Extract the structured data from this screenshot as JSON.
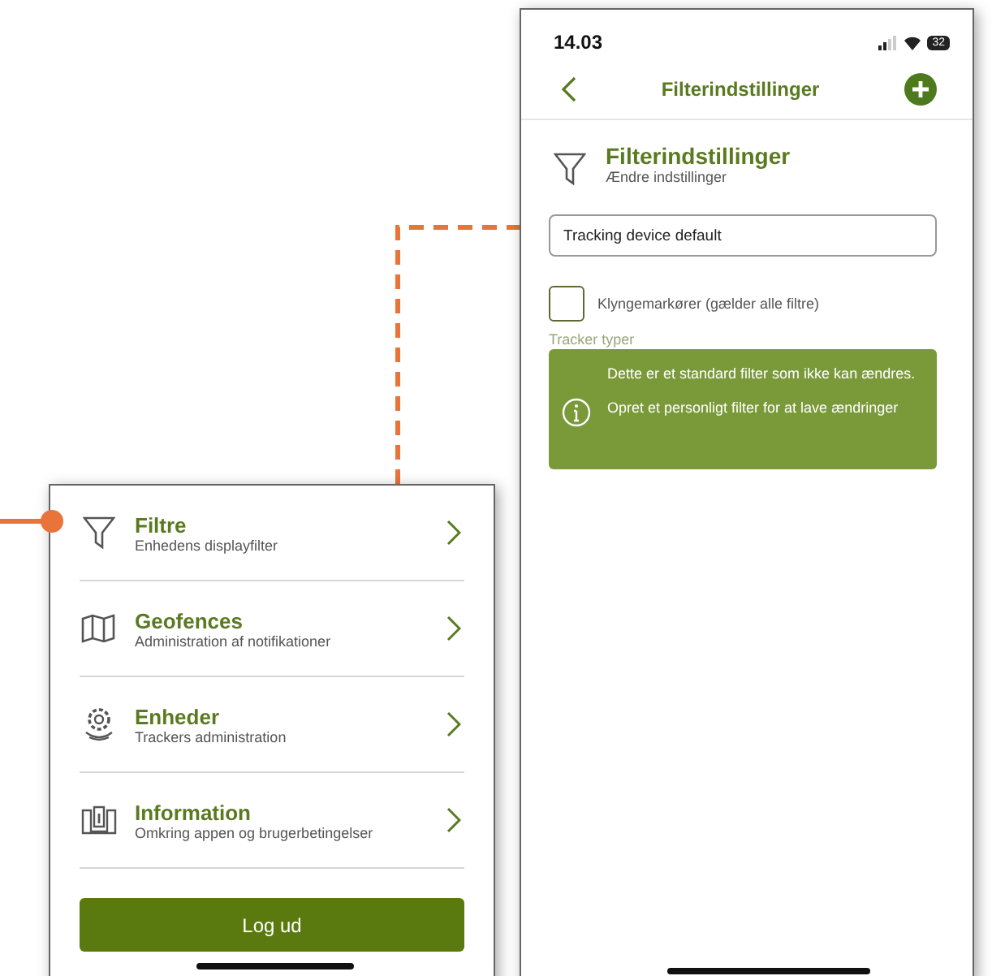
{
  "filter_screen": {
    "status_bar": {
      "time": "14.03",
      "battery": "32"
    },
    "nav_bar": {
      "title": "Filterindstillinger"
    },
    "header": {
      "title": "Filterindstillinger",
      "subtitle": "Ændre indstillinger"
    },
    "name_field": {
      "value": "Tracking device default"
    },
    "cluster_checkbox": {
      "label": "Klyngemarkører (gælder alle filtre)",
      "checked": false
    },
    "section_label": "Tracker typer",
    "notice": {
      "lines": [
        "Dette er et standard filter som ikke kan ændres.",
        "Opret et personligt filter for at lave ændringer"
      ]
    }
  },
  "menu_screen": {
    "items": [
      {
        "kind": "filter",
        "title": "Filtre",
        "subtitle": "Enhedens displayfilter"
      },
      {
        "kind": "map",
        "title": "Geofences",
        "subtitle": "Administration af notifikationer"
      },
      {
        "kind": "gear",
        "title": "Enheder",
        "subtitle": "Trackers administration"
      },
      {
        "kind": "info",
        "title": "Information",
        "subtitle": "Omkring appen og brugerbetingelser"
      }
    ],
    "logout_button": "Log ud"
  }
}
